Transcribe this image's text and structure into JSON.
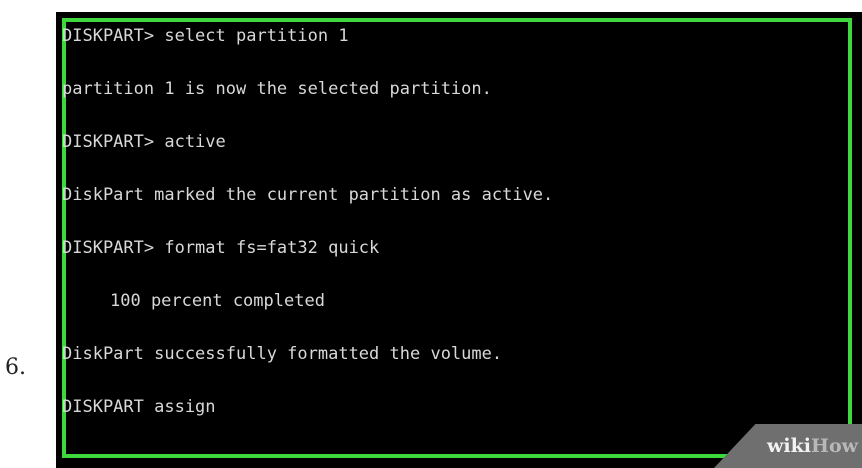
{
  "step": {
    "number": "6."
  },
  "console": {
    "border_color": "#3ed83e",
    "background_color": "#000000",
    "text_color": "#d8d8d8",
    "lines": [
      "DISKPART> select partition 1",
      "partition 1 is now the selected partition.",
      "DISKPART> active",
      "DiskPart marked the current partition as active.",
      "DISKPART> format fs=fat32 quick",
      "100 percent completed",
      "DiskPart successfully formatted the volume.",
      "DISKPART assign"
    ]
  },
  "watermark": {
    "part1": "wiki",
    "part2": "How"
  }
}
